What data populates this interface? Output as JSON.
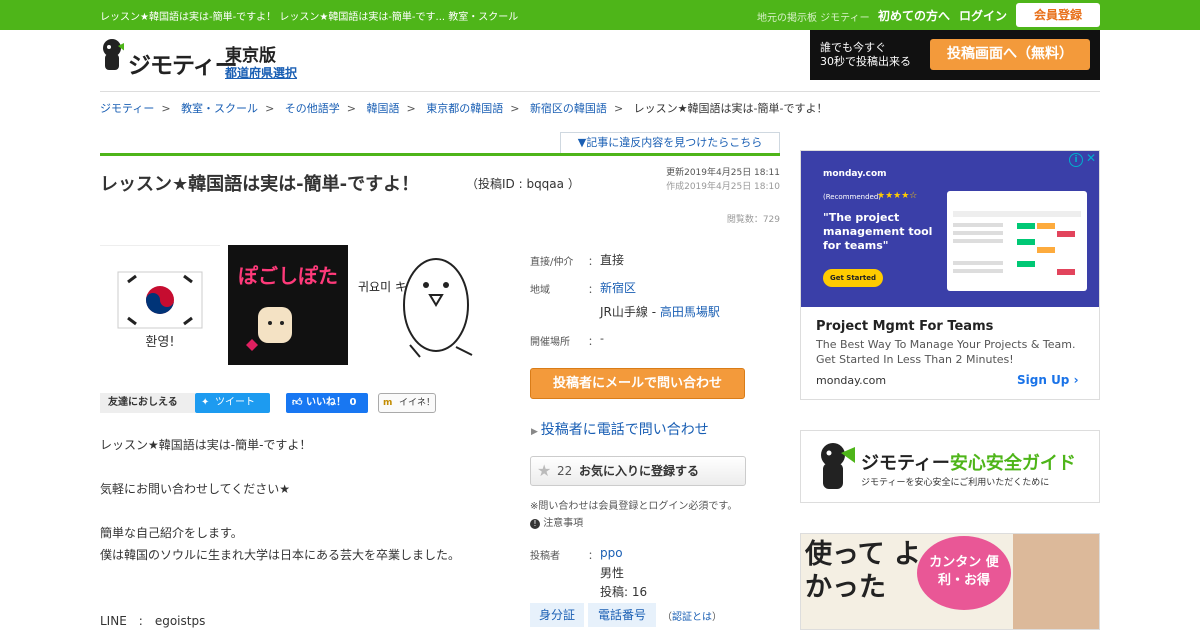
{
  "topbar": {
    "breadcrumb_title": "レッスン★韓国語は実は-簡単-ですよ！ レッスン★韓国語は実は-簡単-です... 教室・スクール",
    "sub": "地元の掲示板 ジモティー",
    "first_time": "初めての方へ",
    "login": "ログイン",
    "register": "会員登録"
  },
  "header": {
    "brand": "ジモティー",
    "region": "東京版",
    "pref_select": "都道府県選択",
    "post_banner_line1": "誰でも今すぐ",
    "post_banner_line2": "30秒で投稿出来る",
    "post_banner_button": "投稿画面へ（無料）"
  },
  "breadcrumb": {
    "items": [
      "ジモティー",
      "教室・スクール",
      "その他語学",
      "韓国語",
      "東京都の韓国語",
      "新宿区の韓国語"
    ],
    "current": "レッスン★韓国語は実は-簡単-ですよ！",
    "sep": ">"
  },
  "post": {
    "violation_link": "▼記事に違反内容を見つけたらこちら",
    "title": "レッスン★韓国語は実は-簡単-ですよ！",
    "post_id": "（投稿ID : bqqaa ）",
    "updated": "更新2019年4月25日 18:11",
    "created": "作成2019年4月25日 18:10",
    "views": "閲覧数：729",
    "images": [
      {
        "caption": "환영!"
      },
      {
        "caption": "ぽごしぽた"
      },
      {
        "caption": "귀요미 キヨミ"
      }
    ],
    "share": {
      "tell_friends": "友達におしえる",
      "tweet": "ツイート",
      "like": "いいね！ 0",
      "iine": "イイネ！"
    },
    "body": [
      "レッスン★韓国語は実は-簡単-ですよ！",
      "気軽にお問い合わせしてください★",
      "簡単な自己紹介をします。",
      "僕は韓国のソウルに生まれ大学は日本にある芸大を卒業しました。",
      "LINE　:　egoistps"
    ]
  },
  "info": {
    "direct_label": "直接/仲介",
    "direct_value": "直接",
    "area_label": "地域",
    "area_value": "新宿区",
    "station_prefix": "JR山手線 - ",
    "station_link": "高田馬場駅",
    "venue_label": "開催場所",
    "venue_value": "-",
    "colon": "：",
    "mail_button": "投稿者にメールで問い合わせ",
    "phone_link": "投稿者に電話で問い合わせ",
    "fav_count": "22",
    "fav_label": "お気に入りに登録する",
    "note": "※問い合わせは会員登録とログイン必須です。",
    "caution": "注意事項",
    "poster_label": "投稿者",
    "poster_name": "ppo",
    "poster_sex": "男性",
    "poster_posts": "投稿: 16",
    "badge_id": "身分証",
    "badge_phone": "電話番号",
    "auth_prefix": "（",
    "auth_link": "認証とは",
    "auth_suffix": "）"
  },
  "ad": {
    "brand": "monday.com",
    "recommended": "(Recommended)",
    "stars": "★★★★☆",
    "quote": "\"The project management tool for teams\"",
    "get_started": "Get Started",
    "headline": "Project Mgmt For Teams",
    "description": "The Best Way To Manage Your Projects & Team. Get Started In Less Than 2 Minutes!",
    "domain": "monday.com",
    "signup": "Sign Up"
  },
  "guide": {
    "title_brand": "ジモティー",
    "title_rest": "安心安全ガイド",
    "sub": "ジモティーを安心安全にご利用いただくために"
  },
  "promo": {
    "big": "使って よかった",
    "bubble": "カンタン 便利・お得"
  },
  "colors": {
    "green": "#4eb519",
    "orange": "#f39a3b",
    "link": "#1a5fb4"
  }
}
